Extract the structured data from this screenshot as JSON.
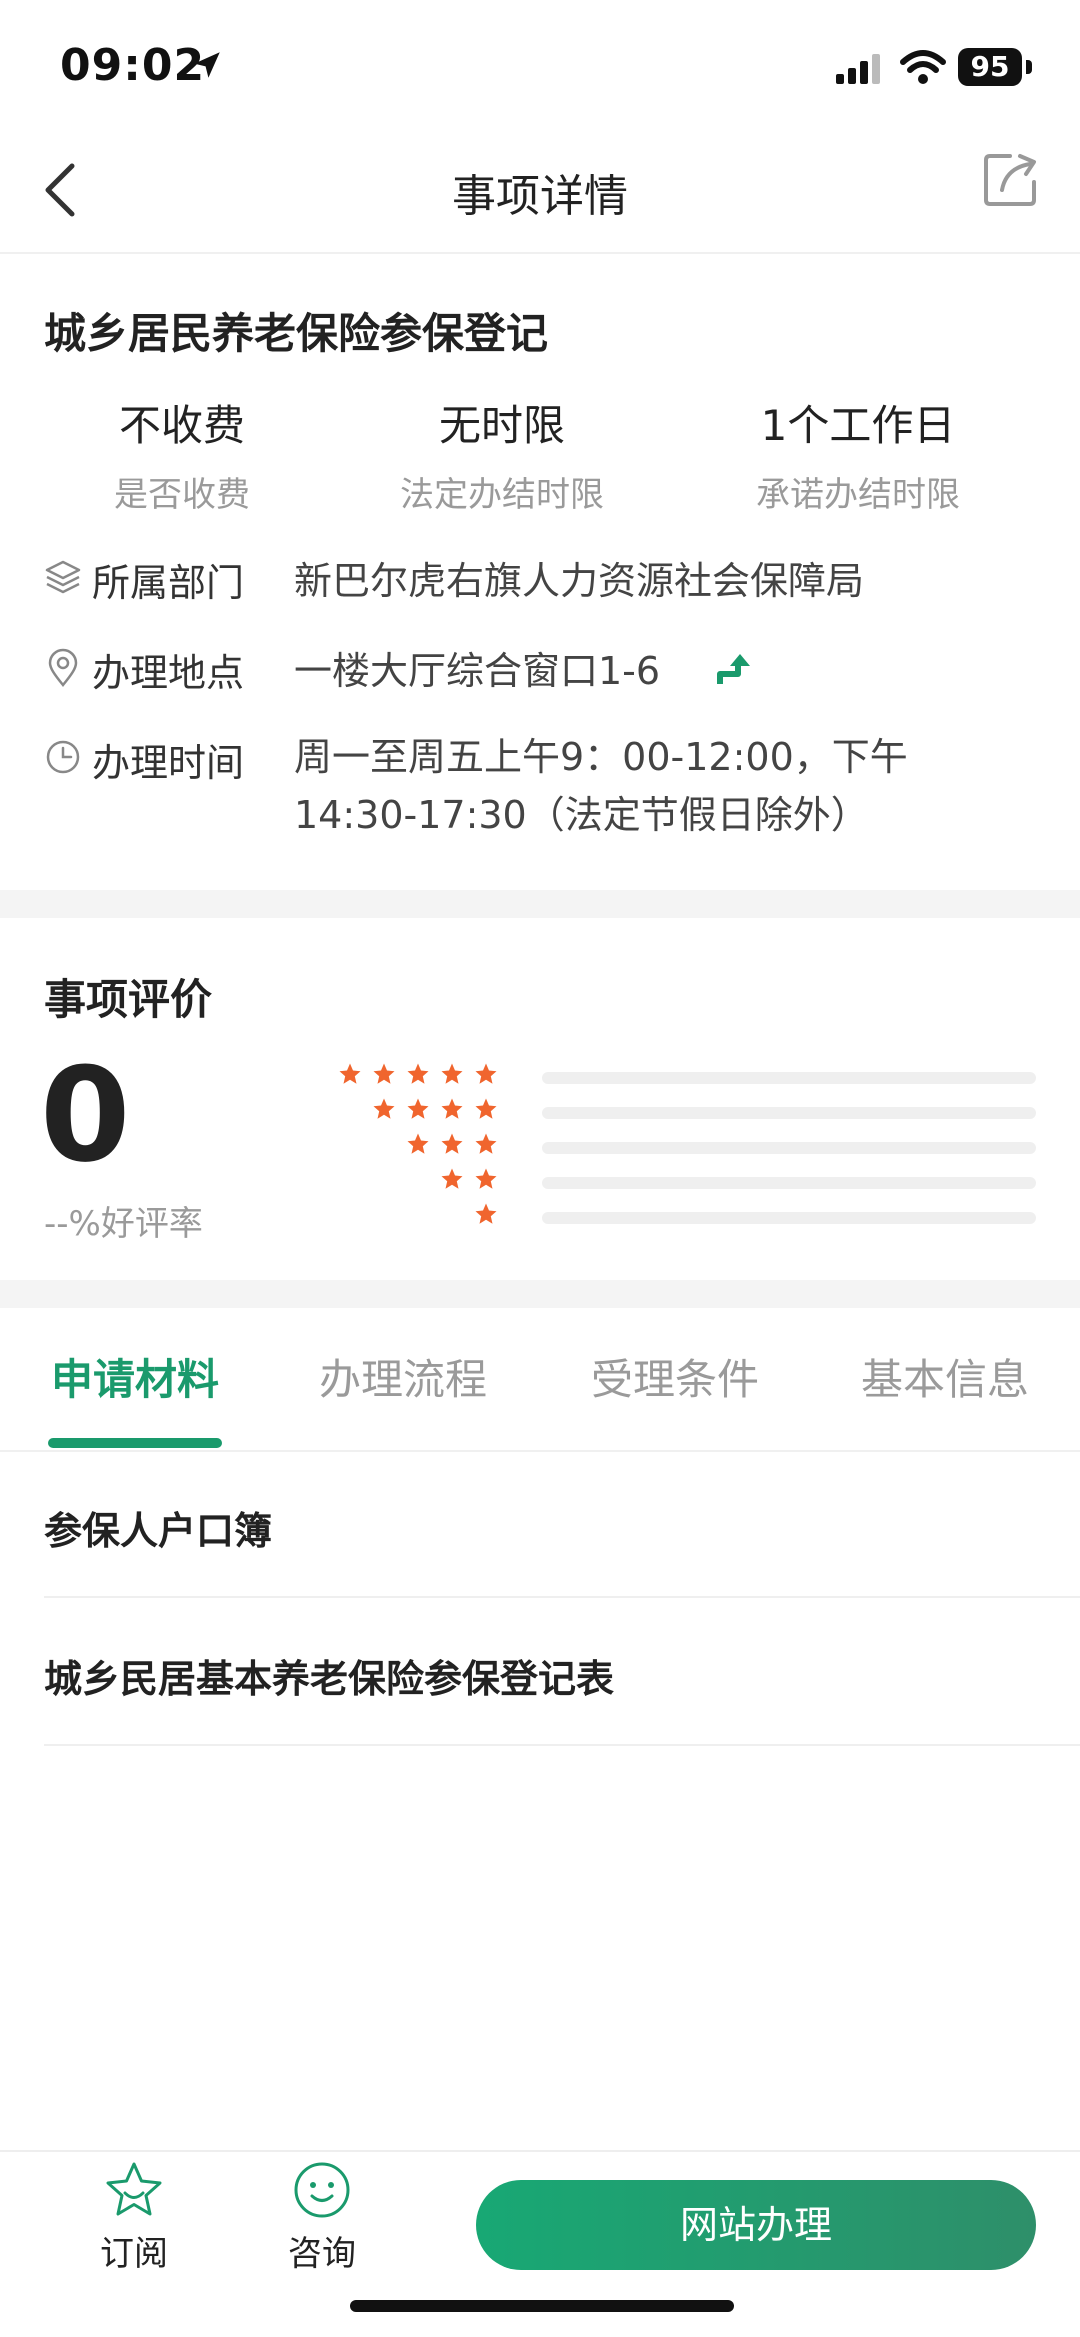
{
  "status_bar": {
    "time": "09:02",
    "battery": "95"
  },
  "nav": {
    "title": "事项详情"
  },
  "item": {
    "title": "城乡居民养老保险参保登记",
    "stats": [
      {
        "value": "不收费",
        "label": "是否收费"
      },
      {
        "value": "无时限",
        "label": "法定办结时限"
      },
      {
        "value": "1个工作日",
        "label": "承诺办结时限"
      }
    ],
    "department": {
      "label": "所属部门",
      "value": "新巴尔虎右旗人力资源社会保障局"
    },
    "location": {
      "label": "办理地点",
      "value": "一楼大厅综合窗口1-6"
    },
    "hours": {
      "label": "办理时间",
      "line1": "周一至周五上午9：00-12:00，下午",
      "line2": "14:30-17:30（法定节假日除外）"
    }
  },
  "evaluation": {
    "title": "事项评价",
    "score": "0",
    "rate": "--%好评率",
    "star_rows": [
      5,
      4,
      3,
      2,
      1
    ],
    "bar_fill": [
      0,
      0,
      0,
      0,
      0
    ]
  },
  "tabs": [
    {
      "label": "申请材料",
      "active": true
    },
    {
      "label": "办理流程",
      "active": false
    },
    {
      "label": "受理条件",
      "active": false
    },
    {
      "label": "基本信息",
      "active": false
    }
  ],
  "materials": [
    "参保人户口簿",
    "城乡民居基本养老保险参保登记表"
  ],
  "bottom": {
    "subscribe": "订阅",
    "consult": "咨询",
    "primary": "网站办理"
  },
  "colors": {
    "accent": "#1a9a6c",
    "star": "#f0652e"
  }
}
